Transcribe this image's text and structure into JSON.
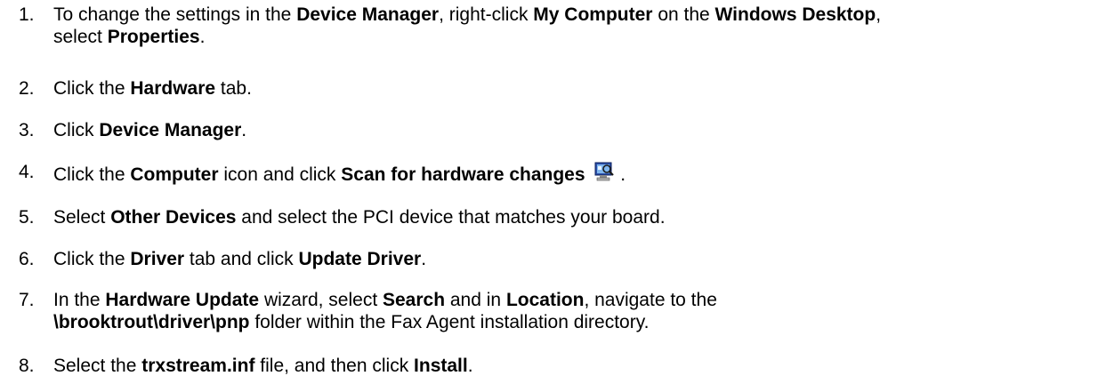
{
  "steps": [
    {
      "num": "1.",
      "line1": [
        {
          "t": "To change the settings in the ",
          "b": false
        },
        {
          "t": "Device Manager",
          "b": true
        },
        {
          "t": ", right-click ",
          "b": false
        },
        {
          "t": "My Computer",
          "b": true
        },
        {
          "t": " on the ",
          "b": false
        },
        {
          "t": "Windows Desktop",
          "b": true
        },
        {
          "t": ",",
          "b": false
        }
      ],
      "line2": [
        {
          "t": "select ",
          "b": false
        },
        {
          "t": "Properties",
          "b": true
        },
        {
          "t": ".",
          "b": false
        }
      ]
    },
    {
      "num": "2.",
      "line1": [
        {
          "t": "Click the ",
          "b": false
        },
        {
          "t": "Hardware",
          "b": true
        },
        {
          "t": " tab.",
          "b": false
        }
      ]
    },
    {
      "num": "3.",
      "line1": [
        {
          "t": "Click ",
          "b": false
        },
        {
          "t": "Device Manager",
          "b": true
        },
        {
          "t": ".",
          "b": false
        }
      ]
    },
    {
      "num": "4.",
      "line1": [
        {
          "t": "Click the ",
          "b": false
        },
        {
          "t": "Computer",
          "b": true
        },
        {
          "t": " icon and click ",
          "b": false
        },
        {
          "t": "Scan for hardware changes",
          "b": true
        }
      ],
      "icon": "scan-hardware-changes-icon",
      "after_icon": "."
    },
    {
      "num": "5.",
      "line1": [
        {
          "t": "Select ",
          "b": false
        },
        {
          "t": "Other Devices",
          "b": true
        },
        {
          "t": " and select the PCI device that matches your board.",
          "b": false
        }
      ]
    },
    {
      "num": "6.",
      "line1": [
        {
          "t": "Click the ",
          "b": false
        },
        {
          "t": "Driver",
          "b": true
        },
        {
          "t": " tab and click ",
          "b": false
        },
        {
          "t": "Update Driver",
          "b": true
        },
        {
          "t": ".",
          "b": false
        }
      ]
    },
    {
      "num": "7.",
      "line1": [
        {
          "t": "In the ",
          "b": false
        },
        {
          "t": "Hardware Update",
          "b": true
        },
        {
          "t": " wizard, select ",
          "b": false
        },
        {
          "t": "Search",
          "b": true
        },
        {
          "t": " and in ",
          "b": false
        },
        {
          "t": "Location",
          "b": true
        },
        {
          "t": ", navigate to the",
          "b": false
        }
      ],
      "line2": [
        {
          "t": "\\brooktrout\\driver\\pnp",
          "b": true
        },
        {
          "t": " folder within the Fax Agent installation directory.",
          "b": false
        }
      ]
    },
    {
      "num": "8.",
      "line1": [
        {
          "t": "Select the ",
          "b": false
        },
        {
          "t": "trxstream.inf",
          "b": true
        },
        {
          "t": " file, and then click ",
          "b": false
        },
        {
          "t": "Install",
          "b": true
        },
        {
          "t": ".",
          "b": false
        }
      ]
    }
  ]
}
